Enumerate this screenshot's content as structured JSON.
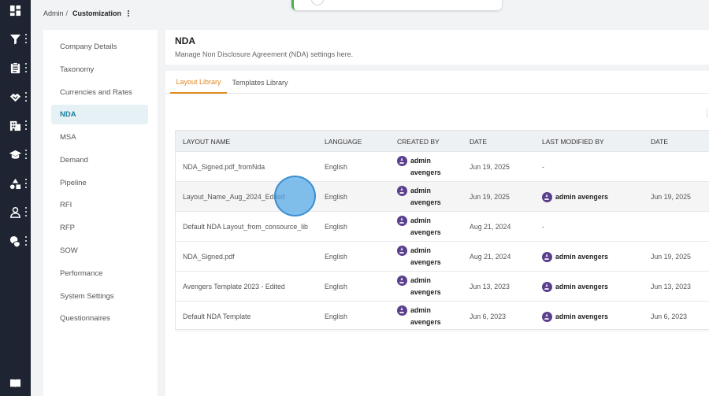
{
  "breadcrumb": {
    "root": "Admin",
    "separator": "/",
    "current": "Customization"
  },
  "rail": {
    "items": [
      {
        "icon": "dashboard-icon",
        "has_menu": false
      },
      {
        "icon": "filter-icon",
        "has_menu": true
      },
      {
        "icon": "clipboard-icon",
        "has_menu": true
      },
      {
        "icon": "handshake-icon",
        "has_menu": true
      },
      {
        "icon": "building-icon",
        "has_menu": true
      },
      {
        "icon": "graduation-cap-icon",
        "has_menu": true
      },
      {
        "icon": "shapes-icon",
        "has_menu": true
      },
      {
        "icon": "user-icon",
        "has_menu": true
      },
      {
        "icon": "user-shield-icon",
        "has_menu": true
      }
    ],
    "bottom_icon": "book-icon"
  },
  "sidebar": {
    "items": [
      {
        "label": "Company Details",
        "active": false
      },
      {
        "label": "Taxonomy",
        "active": false
      },
      {
        "label": "Currencies and Rates",
        "active": false
      },
      {
        "label": "NDA",
        "active": true
      },
      {
        "label": "MSA",
        "active": false
      },
      {
        "label": "Demand",
        "active": false
      },
      {
        "label": "Pipeline",
        "active": false
      },
      {
        "label": "RFI",
        "active": false
      },
      {
        "label": "RFP",
        "active": false
      },
      {
        "label": "SOW",
        "active": false
      },
      {
        "label": "Performance",
        "active": false
      },
      {
        "label": "System Settings",
        "active": false
      },
      {
        "label": "Questionnaires",
        "active": false
      }
    ]
  },
  "page": {
    "title": "NDA",
    "subtitle": "Manage Non Disclosure Agreement (NDA) settings here."
  },
  "tabs": [
    {
      "label": "Layout Library",
      "active": true
    },
    {
      "label": "Templates Library",
      "active": false
    }
  ],
  "table": {
    "headers": [
      "LAYOUT NAME",
      "LANGUAGE",
      "CREATED BY",
      "DATE",
      "LAST MODIFIED BY",
      "DATE"
    ],
    "rows": [
      {
        "name": "NDA_Signed.pdf_fromNda",
        "language": "English",
        "created_by": [
          "admin",
          "avengers"
        ],
        "date": "Jun 19, 2025",
        "modified_by": "-",
        "modified_date": ""
      },
      {
        "name": "Layout_Name_Aug_2024_Edited",
        "language": "English",
        "created_by": [
          "admin",
          "avengers"
        ],
        "date": "Jun 19, 2025",
        "modified_by": "admin avengers",
        "modified_date": "Jun 19, 2025"
      },
      {
        "name": "Default NDA Layout_from_consource_lib",
        "language": "English",
        "created_by": [
          "admin",
          "avengers"
        ],
        "date": "Aug 21, 2024",
        "modified_by": "-",
        "modified_date": ""
      },
      {
        "name": "NDA_Signed.pdf",
        "language": "English",
        "created_by": [
          "admin",
          "avengers"
        ],
        "date": "Aug 21, 2024",
        "modified_by": "admin avengers",
        "modified_date": "Jun 19, 2025"
      },
      {
        "name": "Avengers Template 2023 - Edited",
        "language": "English",
        "created_by": [
          "admin",
          "avengers"
        ],
        "date": "Jun 13, 2023",
        "modified_by": "admin avengers",
        "modified_date": "Jun 13, 2023"
      },
      {
        "name": "Default NDA Template",
        "language": "English",
        "created_by": [
          "admin",
          "avengers"
        ],
        "date": "Jun 6, 2023",
        "modified_by": "admin avengers",
        "modified_date": "Jun 6, 2023"
      }
    ]
  },
  "colors": {
    "rail_bg": "#1e2431",
    "accent_tab": "#e08a22",
    "active_nav_text": "#1d7f9e",
    "active_nav_bg": "#e5f1f4",
    "avatar": "#5a3f8c"
  }
}
